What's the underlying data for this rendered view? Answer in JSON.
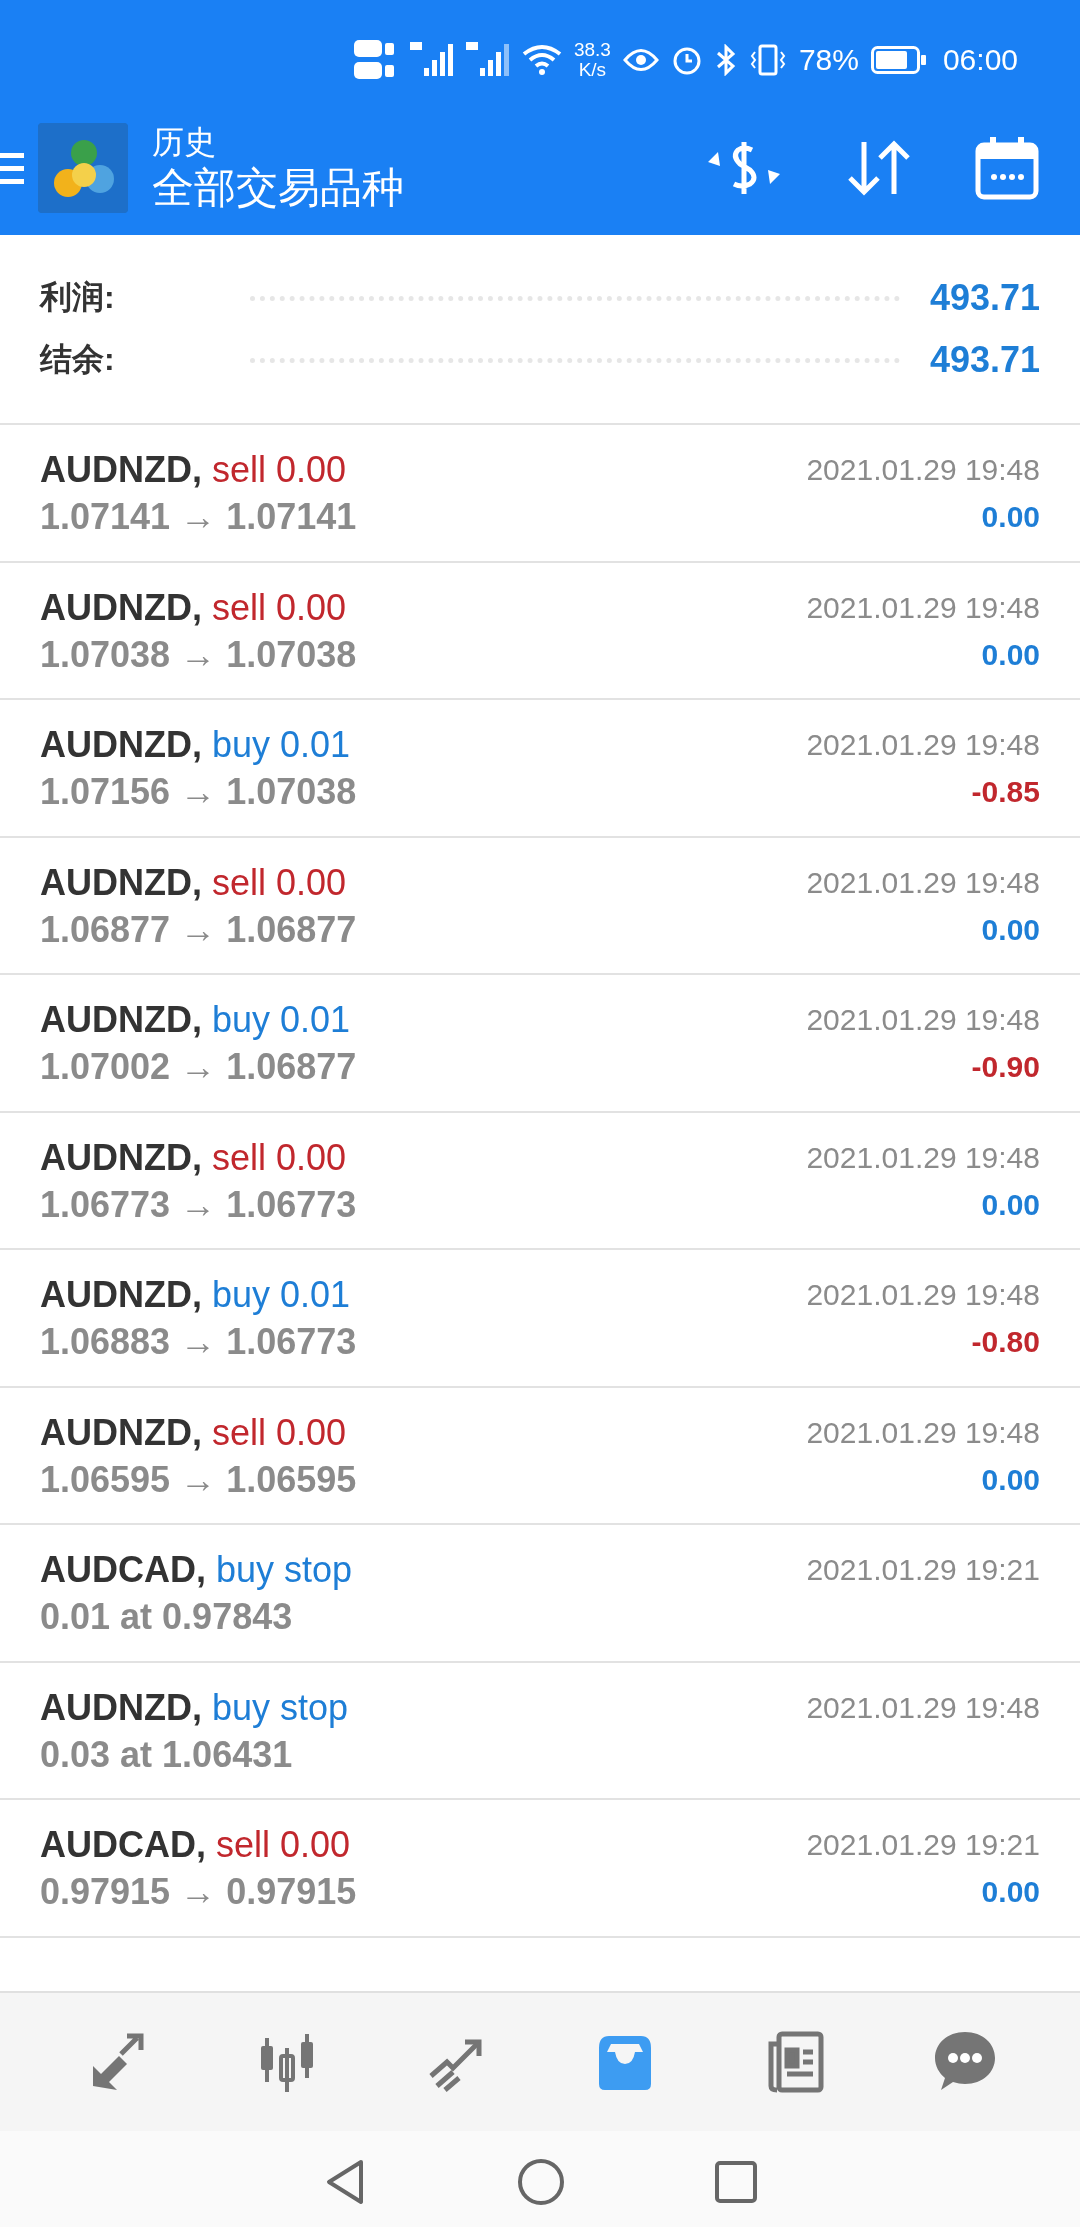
{
  "status_bar": {
    "network_speed": "38.3",
    "speed_unit": "K/s",
    "battery": "78%",
    "time": "06:00"
  },
  "header": {
    "title": "历史",
    "subtitle": "全部交易品种"
  },
  "summary": [
    {
      "label": "利润:",
      "value": "493.71"
    },
    {
      "label": "结余:",
      "value": "493.71"
    }
  ],
  "trades": [
    {
      "symbol": "AUDNZD,",
      "order": {
        "text": "sell 0.00",
        "color": "#c1272d"
      },
      "detail": "1.07141 → 1.07141",
      "time": "2021.01.29 19:48",
      "profit": {
        "text": "0.00",
        "color": "#1e7ed6"
      }
    },
    {
      "symbol": "AUDNZD,",
      "order": {
        "text": "sell 0.00",
        "color": "#c1272d"
      },
      "detail": "1.07038 → 1.07038",
      "time": "2021.01.29 19:48",
      "profit": {
        "text": "0.00",
        "color": "#1e7ed6"
      }
    },
    {
      "symbol": "AUDNZD,",
      "order": {
        "text": "buy 0.01",
        "color": "#1e7ed6"
      },
      "detail": "1.07156 → 1.07038",
      "time": "2021.01.29 19:48",
      "profit": {
        "text": "-0.85",
        "color": "#c1272d"
      }
    },
    {
      "symbol": "AUDNZD,",
      "order": {
        "text": "sell 0.00",
        "color": "#c1272d"
      },
      "detail": "1.06877 → 1.06877",
      "time": "2021.01.29 19:48",
      "profit": {
        "text": "0.00",
        "color": "#1e7ed6"
      }
    },
    {
      "symbol": "AUDNZD,",
      "order": {
        "text": "buy 0.01",
        "color": "#1e7ed6"
      },
      "detail": "1.07002 → 1.06877",
      "time": "2021.01.29 19:48",
      "profit": {
        "text": "-0.90",
        "color": "#c1272d"
      }
    },
    {
      "symbol": "AUDNZD,",
      "order": {
        "text": "sell 0.00",
        "color": "#c1272d"
      },
      "detail": "1.06773 → 1.06773",
      "time": "2021.01.29 19:48",
      "profit": {
        "text": "0.00",
        "color": "#1e7ed6"
      }
    },
    {
      "symbol": "AUDNZD,",
      "order": {
        "text": "buy 0.01",
        "color": "#1e7ed6"
      },
      "detail": "1.06883 → 1.06773",
      "time": "2021.01.29 19:48",
      "profit": {
        "text": "-0.80",
        "color": "#c1272d"
      }
    },
    {
      "symbol": "AUDNZD,",
      "order": {
        "text": "sell 0.00",
        "color": "#c1272d"
      },
      "detail": "1.06595 → 1.06595",
      "time": "2021.01.29 19:48",
      "profit": {
        "text": "0.00",
        "color": "#1e7ed6"
      }
    },
    {
      "symbol": "AUDCAD,",
      "order": {
        "text": "buy stop",
        "color": "#1e7ed6"
      },
      "detail": "0.01 at 0.97843",
      "time": "2021.01.29 19:21"
    },
    {
      "symbol": "AUDNZD,",
      "order": {
        "text": "buy stop",
        "color": "#1e7ed6"
      },
      "detail": "0.03 at 1.06431",
      "time": "2021.01.29 19:48"
    },
    {
      "symbol": "AUDCAD,",
      "order": {
        "text": "sell 0.00",
        "color": "#c1272d"
      },
      "detail": "0.97915 → 0.97915",
      "time": "2021.01.29 19:21",
      "profit": {
        "text": "0.00",
        "color": "#1e7ed6"
      }
    }
  ],
  "bottom_nav": [
    {
      "kind": "trade",
      "selected": false
    },
    {
      "kind": "chart",
      "selected": false
    },
    {
      "kind": "trend",
      "selected": false
    },
    {
      "kind": "history",
      "selected": true
    },
    {
      "kind": "news",
      "selected": false
    },
    {
      "kind": "chat",
      "selected": false
    }
  ]
}
